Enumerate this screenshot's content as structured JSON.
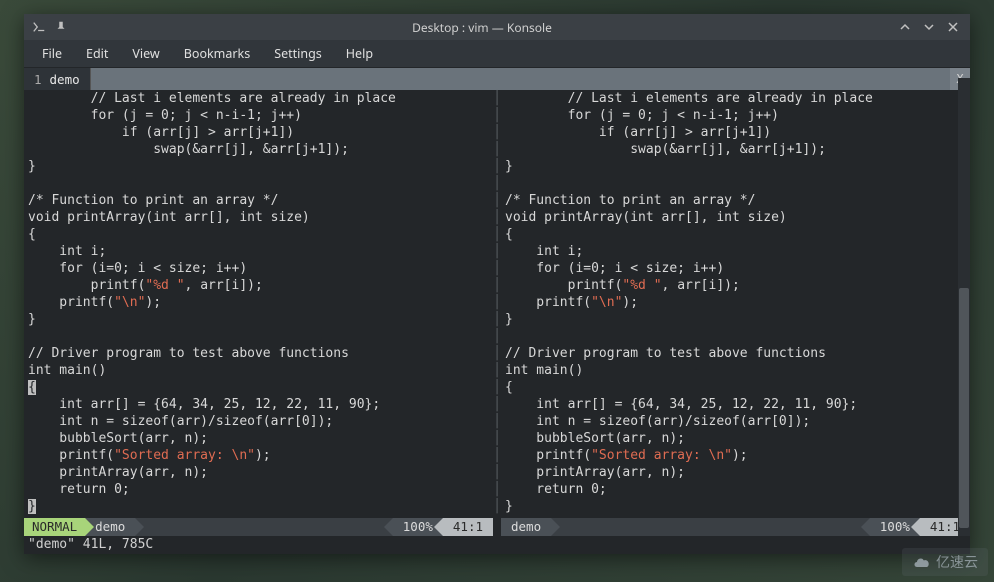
{
  "window": {
    "title": "Desktop : vim — Konsole"
  },
  "menubar": [
    "File",
    "Edit",
    "View",
    "Bookmarks",
    "Settings",
    "Help"
  ],
  "tabs": {
    "index": "1",
    "name": "demo",
    "close_glyph": "X"
  },
  "code": {
    "line0": "        // Last i elements are already in place",
    "line1": "        for (j = 0; j < n-i-1; j++)",
    "line2": "            if (arr[j] > arr[j+1])",
    "line3": "                swap(&arr[j], &arr[j+1]);",
    "line4": "}",
    "line5": "",
    "line6": "/* Function to print an array */",
    "line7": "void printArray(int arr[], int size)",
    "line8": "{",
    "line9": "    int i;",
    "line10": "    for (i=0; i < size; i++)",
    "line11a": "        printf(",
    "line11s": "\"%d \"",
    "line11b": ", arr[i]);",
    "line12a": "    printf(",
    "line12s": "\"\\n\"",
    "line12b": ");",
    "line13": "}",
    "line14": "",
    "line15": "// Driver program to test above functions",
    "line16": "int main()",
    "line17cursor": "{",
    "line17": "{",
    "line18": "    int arr[] = {64, 34, 25, 12, 22, 11, 90};",
    "line19": "    int n = sizeof(arr)/sizeof(arr[0]);",
    "line20": "    bubbleSort(arr, n);",
    "line21a": "    printf(",
    "line21s": "\"Sorted array: \\n\"",
    "line21b": ");",
    "line22": "    printArray(arr, n);",
    "line23": "    return 0;",
    "line24cursor": "}",
    "line24": "}"
  },
  "status_left": {
    "mode": " NORMAL ",
    "file": "demo",
    "pct": "100%",
    "pos": " 41:1 "
  },
  "status_right": {
    "file": "demo",
    "pct": "100%",
    "pos": " 41:1 "
  },
  "cmdline": "\"demo\" 41L, 785C",
  "watermark": "亿速云"
}
